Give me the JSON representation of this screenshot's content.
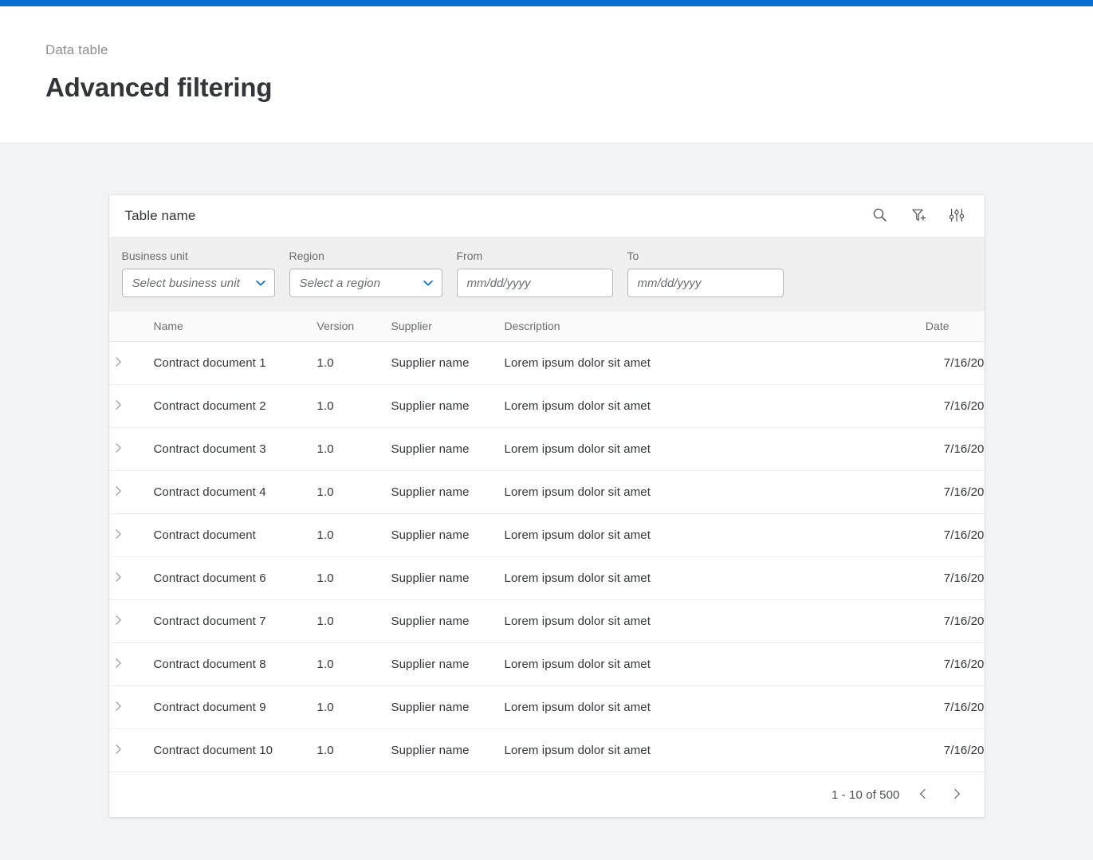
{
  "theme": {
    "accent": "#0a6ed1",
    "page_background": "#f2f3f5",
    "filter_bar_background": "#f0f0f0",
    "text_primary": "#32363b",
    "text_secondary": "#6a6d70"
  },
  "header": {
    "breadcrumb": "Data table",
    "title": "Advanced filtering"
  },
  "card": {
    "table_name": "Table name",
    "toolbar_icons": [
      {
        "name": "search-icon",
        "label": "Search"
      },
      {
        "name": "filter-add-icon",
        "label": "Add filter"
      },
      {
        "name": "settings-sliders-icon",
        "label": "Table settings"
      }
    ]
  },
  "filters": {
    "business_unit": {
      "label": "Business unit",
      "placeholder": "Select business unit",
      "value": ""
    },
    "region": {
      "label": "Region",
      "placeholder": "Select a region",
      "value": ""
    },
    "from": {
      "label": "From",
      "placeholder": "mm/dd/yyyy",
      "value": ""
    },
    "to": {
      "label": "To",
      "placeholder": "mm/dd/yyyy",
      "value": ""
    }
  },
  "table": {
    "columns": {
      "name": "Name",
      "version": "Version",
      "supplier": "Supplier",
      "description": "Description",
      "date": "Date"
    },
    "rows": [
      {
        "name": "Contract document 1",
        "version": "1.0",
        "supplier": "Supplier name",
        "description": "Lorem ipsum dolor sit amet",
        "date": "7/16/20"
      },
      {
        "name": "Contract document 2",
        "version": "1.0",
        "supplier": "Supplier name",
        "description": "Lorem ipsum dolor sit amet",
        "date": "7/16/20"
      },
      {
        "name": "Contract document 3",
        "version": "1.0",
        "supplier": "Supplier name",
        "description": "Lorem ipsum dolor sit amet",
        "date": "7/16/20"
      },
      {
        "name": "Contract document 4",
        "version": "1.0",
        "supplier": "Supplier name",
        "description": "Lorem ipsum dolor sit amet",
        "date": "7/16/20"
      },
      {
        "name": "Contract document",
        "version": "1.0",
        "supplier": "Supplier name",
        "description": "Lorem ipsum dolor sit amet",
        "date": "7/16/20"
      },
      {
        "name": "Contract document 6",
        "version": "1.0",
        "supplier": "Supplier name",
        "description": "Lorem ipsum dolor sit amet",
        "date": "7/16/20"
      },
      {
        "name": "Contract document 7",
        "version": "1.0",
        "supplier": "Supplier name",
        "description": "Lorem ipsum dolor sit amet",
        "date": "7/16/20"
      },
      {
        "name": "Contract document 8",
        "version": "1.0",
        "supplier": "Supplier name",
        "description": "Lorem ipsum dolor sit amet",
        "date": "7/16/20"
      },
      {
        "name": "Contract document 9",
        "version": "1.0",
        "supplier": "Supplier name",
        "description": "Lorem ipsum dolor sit amet",
        "date": "7/16/20"
      },
      {
        "name": "Contract document 10",
        "version": "1.0",
        "supplier": "Supplier name",
        "description": "Lorem ipsum dolor sit amet",
        "date": "7/16/20"
      }
    ]
  },
  "pagination": {
    "info": "1 - 10 of 500",
    "prev_label": "Previous page",
    "next_label": "Next page"
  }
}
